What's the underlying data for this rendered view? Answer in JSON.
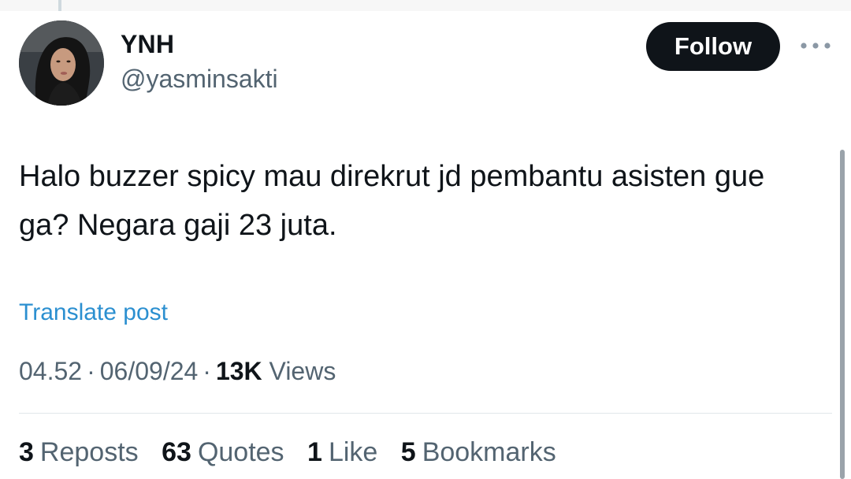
{
  "user": {
    "display_name": "YNH",
    "handle": "@yasminsakti"
  },
  "actions": {
    "follow_label": "Follow",
    "more_icon": "more-horizontal-icon"
  },
  "tweet": {
    "text": "Halo buzzer spicy mau direkrut jd pembantu asisten gue ga? Negara gaji 23 juta.",
    "translate_label": "Translate post"
  },
  "meta": {
    "time": "04.52",
    "separator": "·",
    "date": "06/09/24",
    "views_count": "13K",
    "views_label": "Views"
  },
  "stats": [
    {
      "count": "3",
      "label": "Reposts"
    },
    {
      "count": "63",
      "label": "Quotes"
    },
    {
      "count": "1",
      "label": "Like"
    },
    {
      "count": "5",
      "label": "Bookmarks"
    }
  ],
  "colors": {
    "link": "#2b8fd0",
    "follow_bg": "#0f1419",
    "secondary_text": "#536471"
  }
}
